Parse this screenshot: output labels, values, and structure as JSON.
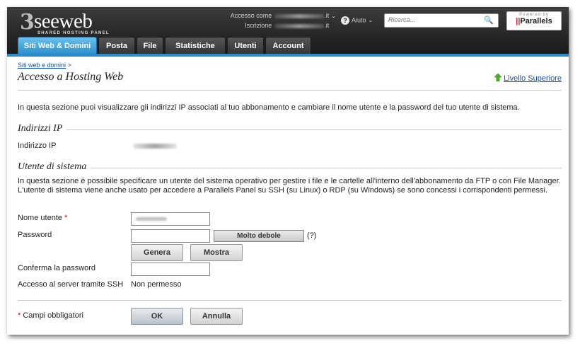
{
  "header": {
    "logo_mark": "3",
    "logo_name": "seeweb",
    "logo_tagline": "SHARED HOSTING PANEL",
    "login_label": "Accesso come",
    "login_tld": ".it",
    "subscription_label": "Iscrizione",
    "subscription_tld": ".it",
    "help_label": "Aiuto",
    "search_placeholder": "Ricerca...",
    "parallels_powered": "Powered by",
    "parallels_name": "Parallels"
  },
  "tabs": [
    {
      "label": "Siti Web & Domini",
      "active": true
    },
    {
      "label": "Posta"
    },
    {
      "label": "File"
    },
    {
      "label": "Statistiche"
    },
    {
      "label": "Utenti"
    },
    {
      "label": "Account"
    }
  ],
  "breadcrumb": {
    "link": "Siti web e domini",
    "separator": ">"
  },
  "page": {
    "title": "Accesso a Hosting Web",
    "upper_level": "Livello Superiore",
    "intro": "In questa sezione puoi visualizzare gli indirizzi IP associati al tuo abbonamento e cambiare il nome utente e la password del tuo utente di sistema."
  },
  "ip_section": {
    "legend": "Indirizzi IP",
    "ip_label": "Indirizzo IP"
  },
  "user_section": {
    "legend": "Utente di sistema",
    "description": "In questa sezione è possibile specificare un utente del sistema operativo per gestire i file e le cartelle all'interno dell'abbonamento da FTP o con File Manager. L'utente di sistema viene anche usato per accedere a Parallels Panel su SSH (su Linux) o RDP (su Windows) se sono concessi i corrispondenti permessi.",
    "username_label": "Nome utente",
    "required_mark": "*",
    "password_label": "Password",
    "password_strength": "Molto debole",
    "strength_help": "(?)",
    "generate_button": "Genera",
    "show_button": "Mostra",
    "confirm_label": "Conferma la password",
    "ssh_label": "Accesso al server tramite SSH",
    "ssh_value": "Non permesso"
  },
  "footer": {
    "required_note": "* Campi obbligatori",
    "ok_button": "OK",
    "cancel_button": "Annulla"
  },
  "colors": {
    "accent": "#2a8ccc",
    "link": "#1a4f9e",
    "required": "#cc0000"
  }
}
